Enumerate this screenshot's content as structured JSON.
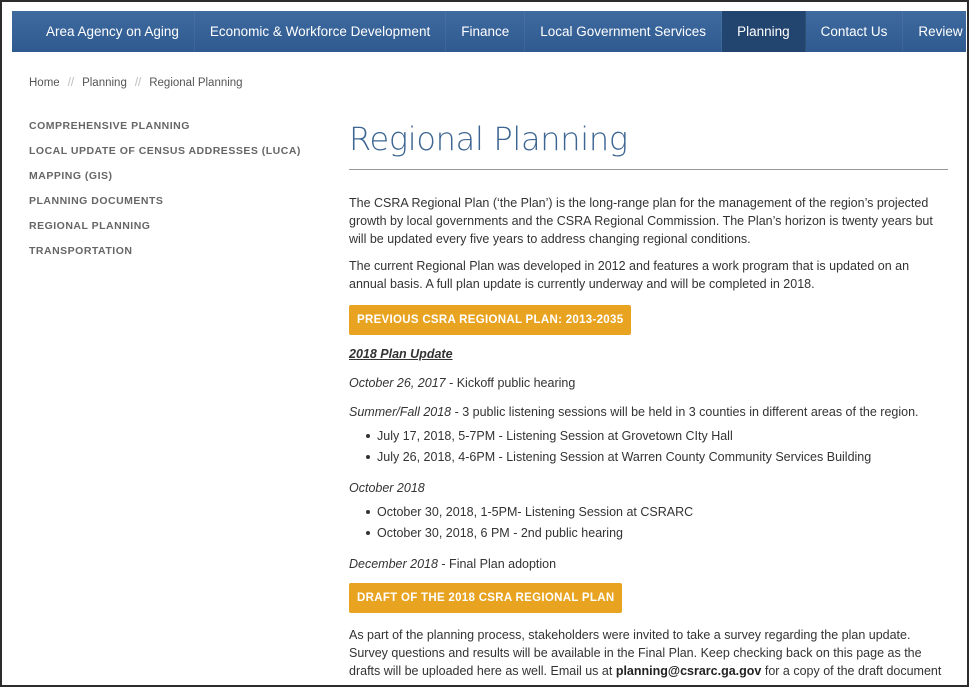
{
  "nav": {
    "items": [
      {
        "label": "Area Agency on Aging"
      },
      {
        "label": "Economic & Workforce Development"
      },
      {
        "label": "Finance"
      },
      {
        "label": "Local Government Services"
      },
      {
        "label": "Planning"
      },
      {
        "label": "Contact Us"
      },
      {
        "label": "Review Docs"
      }
    ],
    "active": "Planning"
  },
  "breadcrumb": {
    "home": "Home",
    "planning": "Planning",
    "current": "Regional Planning",
    "separator": "//"
  },
  "sidebar": {
    "items": [
      {
        "label": "COMPREHENSIVE PLANNING"
      },
      {
        "label": "LOCAL UPDATE OF CENSUS ADDRESSES (LUCA)"
      },
      {
        "label": "MAPPING (GIS)"
      },
      {
        "label": "PLANNING DOCUMENTS"
      },
      {
        "label": "REGIONAL PLANNING"
      },
      {
        "label": "TRANSPORTATION"
      }
    ]
  },
  "main": {
    "title": "Regional Planning",
    "p1": "The CSRA Regional Plan (‘the Plan’) is the long-range plan for the management of the region’s projected growth by local governments and the CSRA Regional Commission.  The Plan’s horizon is twenty years but will be updated every five years to address changing regional conditions.",
    "p2": "The current Regional Plan was developed in 2012 and features a work program that is updated on an annual basis.  A full plan update is currently underway and will be completed in 2018.",
    "button1": "PREVIOUS CSRA REGIONAL PLAN: 2013-2035",
    "subhead": "2018 Plan Update",
    "ev1_date": "October 26, 2017",
    "ev1_text": " - Kickoff public hearing",
    "ev2_date": "Summer/Fall 2018",
    "ev2_text": " - 3 public listening sessions will be held in 3 counties in different areas of the region.",
    "list1": [
      "July 17, 2018, 5-7PM - Listening Session at Grovetown CIty Hall",
      "July 26, 2018, 4-6PM - Listening Session at Warren County Community Services Building"
    ],
    "ev3_date": "October 2018",
    "list2": [
      "October 30, 2018, 1-5PM- Listening Session at CSRARC",
      "October 30, 2018, 6 PM - 2nd public hearing"
    ],
    "ev4_date": "December 2018",
    "ev4_text": " - Final Plan adoption",
    "button2": "DRAFT OF THE 2018 CSRA REGIONAL PLAN",
    "p3_a": "As part of the planning process, stakeholders were invited to take a survey regarding the plan update. Survey questions and results will be available in the Final Plan.  Keep checking back on this page as the drafts will be uploaded here as well.  Email us at ",
    "p3_email": "planning@csrarc.ga.gov",
    "p3_b": " for a copy of the draft document"
  },
  "colors": {
    "nav_bg": "#3f6aa0",
    "nav_active": "#22456f",
    "title": "#3d6592",
    "button": "#e8a321"
  }
}
